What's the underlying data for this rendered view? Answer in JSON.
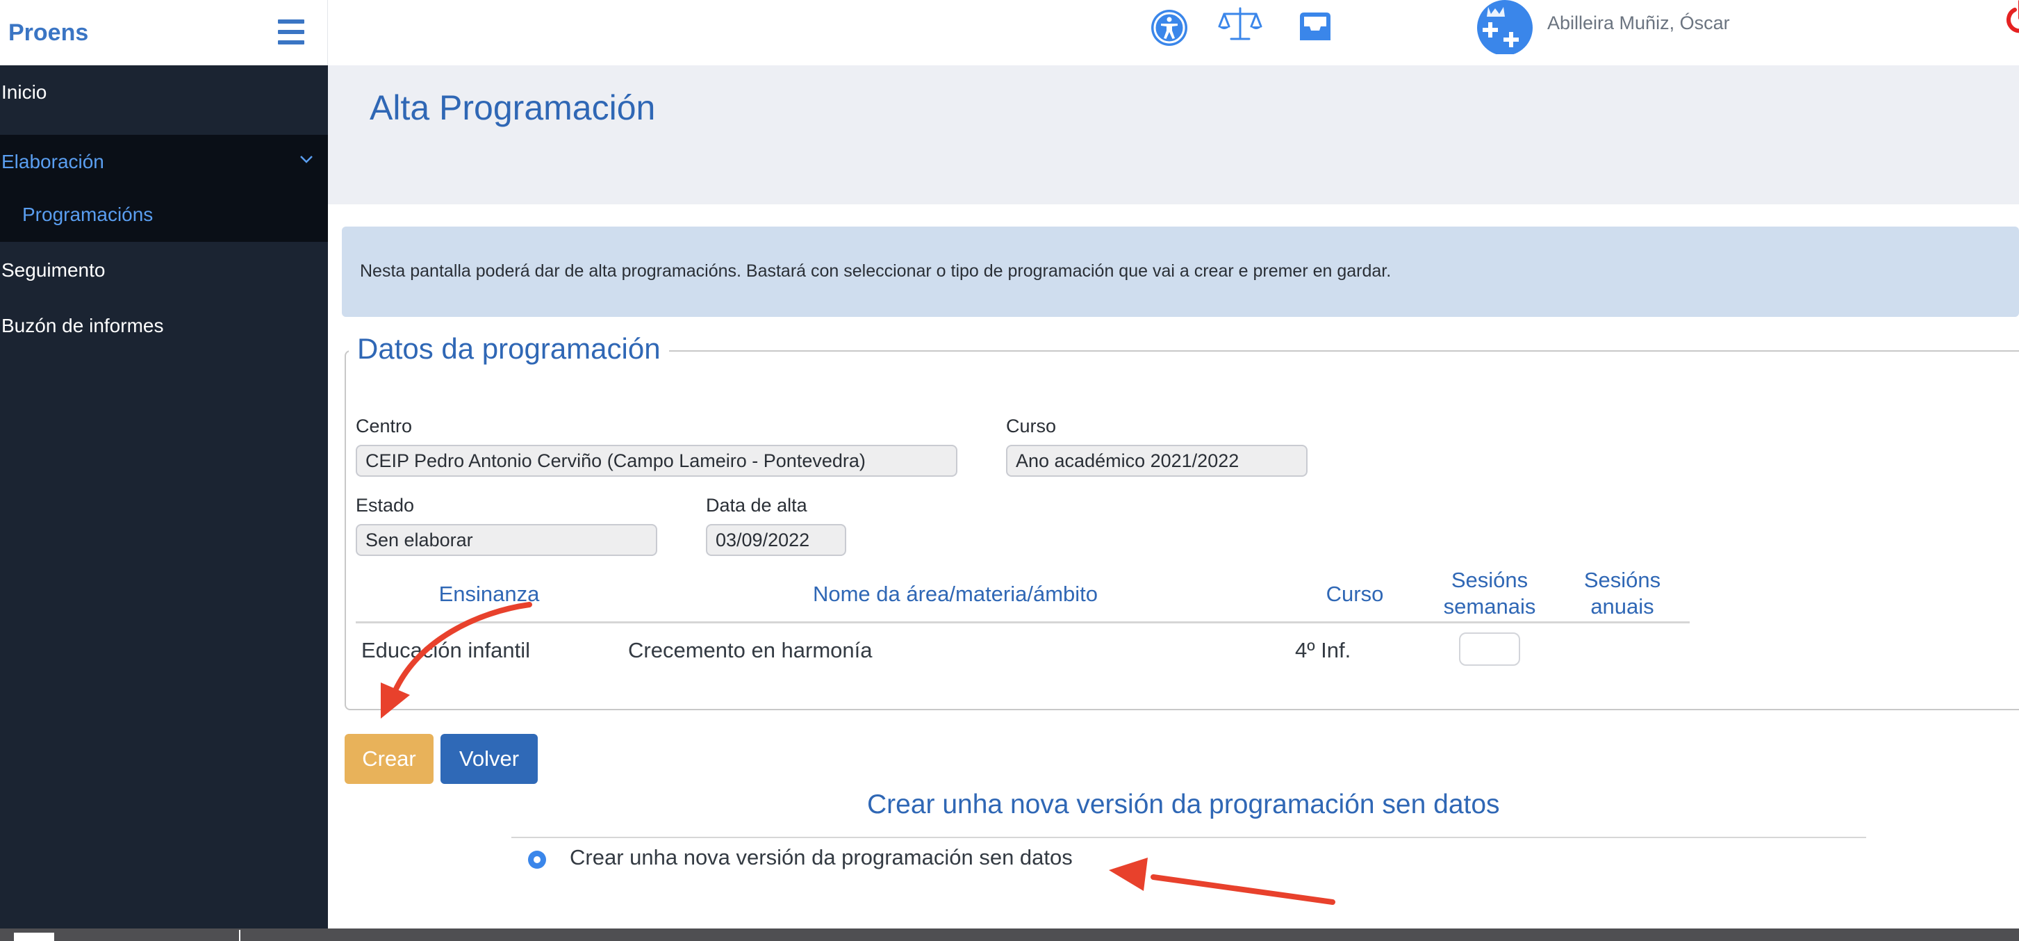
{
  "brand": {
    "name": "Proens"
  },
  "header": {
    "user_name": "Abilleira Muñiz, Óscar",
    "icons": [
      "accessibility-icon",
      "scales-icon",
      "inbox-icon",
      "xunta-avatar-icon",
      "power-icon"
    ]
  },
  "sidebar": {
    "items": [
      {
        "label": "Inicio"
      },
      {
        "label": "Elaboración",
        "expanded": true
      },
      {
        "label": "Programacións",
        "active": true
      },
      {
        "label": "Seguimento"
      },
      {
        "label": "Buzón de informes"
      }
    ]
  },
  "page": {
    "title": "Alta Programación",
    "info": "Nesta pantalla poderá dar de alta programacións. Bastará con seleccionar o tipo de programación que vai a crear e premer en gardar."
  },
  "form": {
    "legend": "Datos da programación",
    "centro_label": "Centro",
    "centro_value": "CEIP Pedro Antonio Cerviño (Campo Lameiro - Pontevedra)",
    "curso_label": "Curso",
    "curso_value": "Ano académico 2021/2022",
    "estado_label": "Estado",
    "estado_value": "Sen elaborar",
    "data_label": "Data de alta",
    "data_value": "03/09/2022"
  },
  "table": {
    "headers": {
      "ensinanza": "Ensinanza",
      "nome": "Nome da área/materia/ámbito",
      "curso": "Curso",
      "ses_sem_1": "Sesións",
      "ses_sem_2": "semanais",
      "ses_anu_1": "Sesións",
      "ses_anu_2": "anuais"
    },
    "rows": [
      {
        "ensinanza": "Educación infantil",
        "nome": "Crecemento en harmonía",
        "curso": "4º Inf.",
        "sesions_semanais": "",
        "sesions_anuais": ""
      }
    ]
  },
  "actions": {
    "crear": "Crear",
    "volver": "Volver"
  },
  "version": {
    "title": "Crear unha nova versión da programación sen datos",
    "option": "Crear unha nova versión da programación sen datos",
    "selected": true
  },
  "colors": {
    "brand_blue": "#2f67b5",
    "sidebar_bg": "#1b2432",
    "crear_btn": "#e8b25a",
    "volver_btn": "#2f69b7",
    "annotation_arrow": "#e8412c",
    "info_bg": "#cfddee"
  }
}
